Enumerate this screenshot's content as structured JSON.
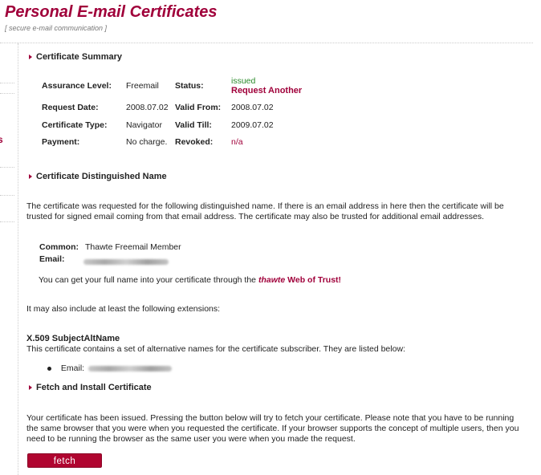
{
  "header": {
    "title": "Personal E-mail Certificates",
    "subtitle": "[ secure e-mail communication ]"
  },
  "sidebar": {
    "edge_text": "s"
  },
  "summary": {
    "heading": "Certificate Summary",
    "assurance_label": "Assurance Level:",
    "assurance_value": "Freemail",
    "status_label": "Status:",
    "status_value": "issued",
    "request_another_link": "Request Another",
    "request_date_label": "Request Date:",
    "request_date_value": "2008.07.02",
    "valid_from_label": "Valid From:",
    "valid_from_value": "2008.07.02",
    "type_label": "Certificate Type:",
    "type_value": "Navigator",
    "valid_till_label": "Valid Till:",
    "valid_till_value": "2009.07.02",
    "payment_label": "Payment:",
    "payment_value": "No charge.",
    "revoked_label": "Revoked:",
    "revoked_value": "n/a"
  },
  "dn": {
    "heading": "Certificate Distinguished Name",
    "intro": "The certificate was requested for the following distinguished name. If there is an email address in here then the certificate will be trusted for signed email coming from that email address. The certificate may also be trusted for additional email addresses.",
    "common_label": "Common:",
    "common_value": "Thawte Freemail Member",
    "email_label": "Email:",
    "wot_text": "You can get your full name into your certificate through the",
    "wot_brand": "thawte",
    "wot_link": "Web of Trust!",
    "extensions_text": "It may also include at least the following extensions:",
    "x509_heading": "X.509 SubjectAltName",
    "x509_text": "This certificate contains a set of alternative names for the certificate subscriber. They are listed below:",
    "alt_email_label": "Email:"
  },
  "fetch": {
    "heading": "Fetch and Install Certificate",
    "text": "Your certificate has been issued. Pressing the button below will try to fetch your certificate. Please note that you have to be running the same browser that you were when you requested the certificate. If your browser supports the concept of multiple users, then you need to be running the browser as the same user you were when you made the request.",
    "button_label": "fetch"
  },
  "colors": {
    "brand": "#a0003a",
    "status_issued": "#2a8a2a",
    "button": "#b00530"
  },
  "icons": [
    "section-arrow-icon",
    "bullet-icon"
  ]
}
